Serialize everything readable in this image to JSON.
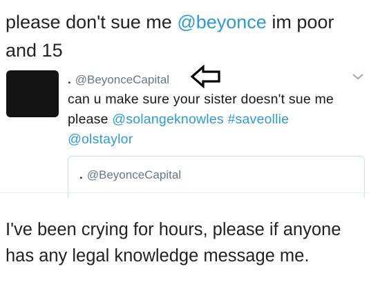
{
  "caption_top": {
    "before": "please don't sue me ",
    "mention": "@beyonce",
    "after": " im poor and 15"
  },
  "tweet": {
    "dot": ".",
    "handle": "@BeyonceCapital",
    "body": {
      "text": "can u make sure your sister doesn't sue me please ",
      "mention_1": "@solangeknowles",
      "hashtag": "#saveollie",
      "mention_2": "@olstaylor"
    },
    "quote": {
      "dot": ".",
      "handle": "@BeyonceCapital"
    },
    "icons": {
      "pointer": "arrow-left-outline-icon",
      "menu": "chevron-down-icon"
    }
  },
  "caption_bottom": "I've been crying for hours, please if anyone has any legal knowledge message me.",
  "colors": {
    "link": "#2b9bd8",
    "handle_gray": "#657786",
    "avatar": "#141414"
  }
}
